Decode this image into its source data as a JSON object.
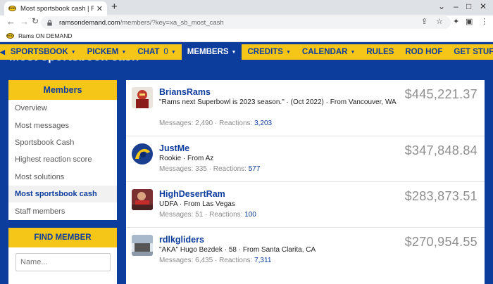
{
  "browser": {
    "tab_title": "Most sportsbook cash | Rams ON DEMAND",
    "url_host": "ramsondemand.com",
    "url_path": "/members/?key=xa_sb_most_cash",
    "bookmark": "Rams ON DEMAND",
    "favicon_text": "ROD"
  },
  "nav": {
    "items": [
      {
        "label": "SPORTSBOOK",
        "dropdown": true
      },
      {
        "label": "PICKEM",
        "dropdown": true
      },
      {
        "label": "CHAT",
        "count": "0",
        "dropdown": true
      },
      {
        "label": "MEMBERS",
        "dropdown": true,
        "active": true
      },
      {
        "label": "CREDITS",
        "dropdown": true
      },
      {
        "label": "CALENDAR",
        "dropdown": true
      },
      {
        "label": "RULES"
      },
      {
        "label": "ROD HOF"
      },
      {
        "label": "GET STUFF"
      }
    ]
  },
  "page": {
    "title": "Most sportsbook cash"
  },
  "sidebar": {
    "title": "Members",
    "items": [
      "Overview",
      "Most messages",
      "Sportsbook Cash",
      "Highest reaction score",
      "Most solutions",
      "Most sportsbook cash",
      "Staff members"
    ],
    "active": "Most sportsbook cash"
  },
  "find_member": {
    "title": "FIND MEMBER",
    "placeholder": "Name..."
  },
  "members": [
    {
      "name": "BriansRams",
      "blurb": "\"Rams next Superbowl is 2023 season.\" · (Oct 2022) · From Vancouver, WA",
      "messages_label": "Messages:",
      "messages": "2,490",
      "reactions_label": "Reactions:",
      "reactions": "3,203",
      "cash": "$445,221.37"
    },
    {
      "name": "JustMe",
      "blurb": "Rookie · From Az",
      "messages_label": "Messages:",
      "messages": "335",
      "reactions_label": "Reactions:",
      "reactions": "577",
      "cash": "$347,848.84"
    },
    {
      "name": "HighDesertRam",
      "blurb": "UDFA · From Las Vegas",
      "messages_label": "Messages:",
      "messages": "51",
      "reactions_label": "Reactions:",
      "reactions": "100",
      "cash": "$283,873.51"
    },
    {
      "name": "rdlkgliders",
      "blurb": "\"AKA\" Hugo Bezdek · 58 · From Santa Clarita, CA",
      "messages_label": "Messages:",
      "messages": "6,435",
      "reactions_label": "Reactions:",
      "reactions": "7,311",
      "cash": "$270,954.55"
    }
  ],
  "colors": {
    "brand_blue": "#0c3c9c",
    "brand_gold": "#f5c518"
  }
}
